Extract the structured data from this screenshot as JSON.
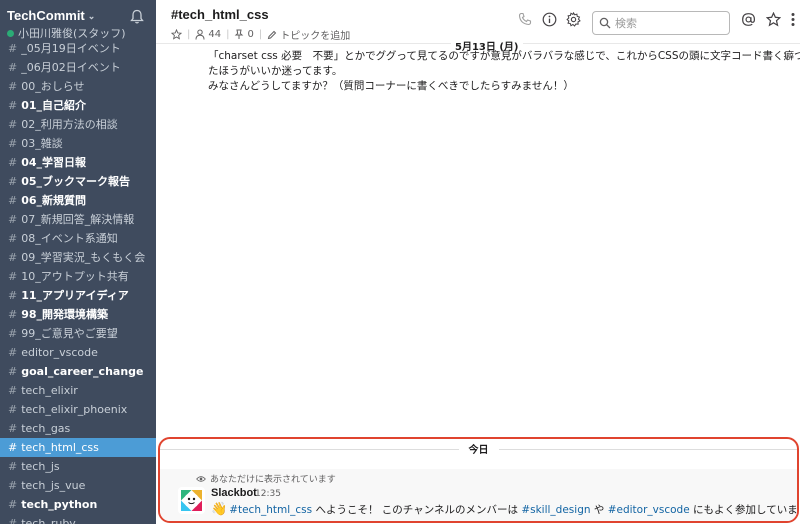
{
  "workspace": {
    "name": "TechCommit",
    "user_status": "小田川雅俊(スタッフ)"
  },
  "channels": [
    {
      "name": "_05月19日イベント",
      "bold": false,
      "active": false
    },
    {
      "name": "_06月02日イベント",
      "bold": false,
      "active": false
    },
    {
      "name": "00_おしらせ",
      "bold": false,
      "active": false
    },
    {
      "name": "01_自己紹介",
      "bold": true,
      "active": false
    },
    {
      "name": "02_利用方法の相談",
      "bold": false,
      "active": false
    },
    {
      "name": "03_雑談",
      "bold": false,
      "active": false
    },
    {
      "name": "04_学習日報",
      "bold": true,
      "active": false
    },
    {
      "name": "05_ブックマーク報告",
      "bold": true,
      "active": false
    },
    {
      "name": "06_新規質問",
      "bold": true,
      "active": false
    },
    {
      "name": "07_新規回答_解決情報",
      "bold": false,
      "active": false
    },
    {
      "name": "08_イベント系通知",
      "bold": false,
      "active": false
    },
    {
      "name": "09_学習実況_もくもく会",
      "bold": false,
      "active": false
    },
    {
      "name": "10_アウトプット共有",
      "bold": false,
      "active": false
    },
    {
      "name": "11_アプリアイディア",
      "bold": true,
      "active": false
    },
    {
      "name": "98_開発環境構築",
      "bold": true,
      "active": false
    },
    {
      "name": "99_ご意見やご要望",
      "bold": false,
      "active": false
    },
    {
      "name": "editor_vscode",
      "bold": false,
      "active": false
    },
    {
      "name": "goal_career_change",
      "bold": true,
      "active": false
    },
    {
      "name": "tech_elixir",
      "bold": false,
      "active": false
    },
    {
      "name": "tech_elixir_phoenix",
      "bold": false,
      "active": false
    },
    {
      "name": "tech_gas",
      "bold": false,
      "active": false
    },
    {
      "name": "tech_html_css",
      "bold": false,
      "active": true
    },
    {
      "name": "tech_js",
      "bold": false,
      "active": false
    },
    {
      "name": "tech_js_vue",
      "bold": false,
      "active": false
    },
    {
      "name": "tech_python",
      "bold": true,
      "active": false
    },
    {
      "name": "tech_ruby",
      "bold": false,
      "active": false
    }
  ],
  "header": {
    "title": "#tech_html_css",
    "members": "44",
    "pins": "0",
    "topic": "トピックを追加",
    "search_placeholder": "検索"
  },
  "date_divider": "5月13日 (月)",
  "old_message": {
    "lines": [
      "「charset css 必要　不要」とかでググって見てるのですが意見がバラバラな感じで、これからCSSの頭に文字コード書く癖つけ",
      "たほうがいいか迷ってます。",
      "みなさんどうしてますか？（質問コーナーに書くべきでしたらすみません！）"
    ]
  },
  "today_section": {
    "label": "今日",
    "ephemeral_note": "あなただけに表示されています",
    "bot_name": "Slackbot",
    "time": "12:35",
    "text_parts": {
      "link1": "#tech_html_css",
      "mid1": " へようこそ！ このチャンネルのメンバーは ",
      "link2": "#skill_design",
      "mid2": " や ",
      "link3": "#editor_vscode",
      "end": " にもよく参加しています。"
    }
  },
  "colors": {
    "sidebar_bg": "#3f4b5e",
    "active_channel": "#4c9cd6",
    "highlight_border": "#e0442f",
    "link": "#1264a3"
  }
}
